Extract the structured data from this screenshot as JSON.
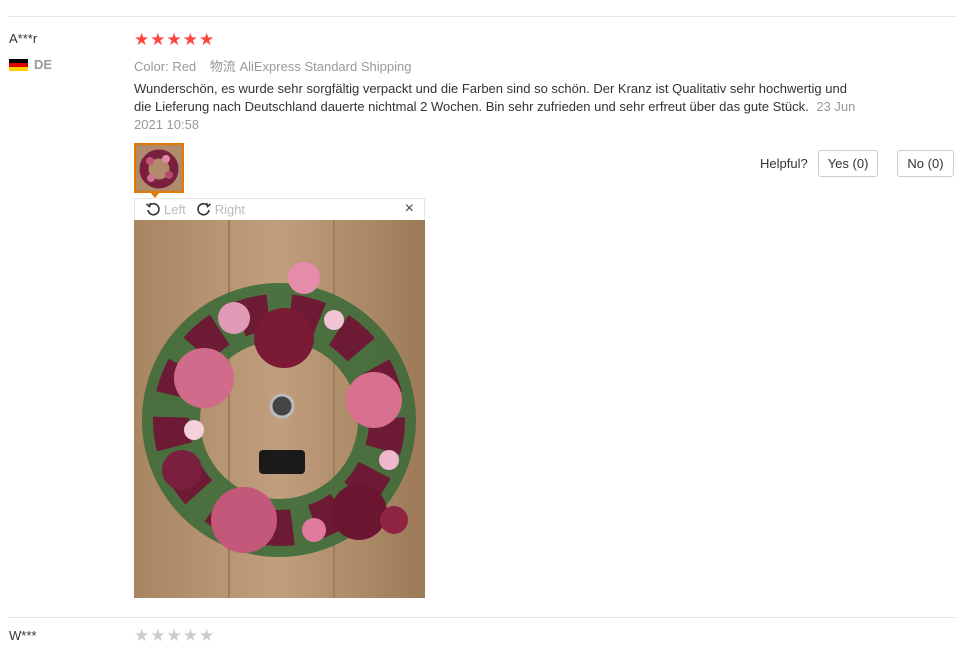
{
  "review": {
    "user": "A***r",
    "country": "DE",
    "rating": 5,
    "stars": [
      "★",
      "★",
      "★",
      "★",
      "★"
    ],
    "color_label": "Color:",
    "color_value": "Red",
    "shipping_label": "物流",
    "shipping_value": "AliExpress Standard Shipping",
    "text": "Wunderschön, es wurde sehr sorgfältig verpackt und die Farben sind so schön. Der Kranz ist Qualitativ sehr hochwertig und die Lieferung nach Deutschland dauerte nichtmal 2 Wochen. Bin sehr zufrieden und sehr erfreut über das gute Stück.",
    "date": "23 Jun 2021 10:58"
  },
  "helpful": {
    "label": "Helpful?",
    "yes": "Yes (0)",
    "no": "No (0)"
  },
  "viewer": {
    "rotate_left": "Left",
    "rotate_right": "Right",
    "close": "×"
  },
  "next_review": {
    "user": "W***",
    "stars": [
      "★",
      "★",
      "★",
      "★",
      "★"
    ]
  },
  "colors": {
    "star": "#ff4444",
    "thumb_border": "#e07b00",
    "muted": "#999999"
  },
  "icons": {
    "rotate_left": "rotate-left-icon",
    "rotate_right": "rotate-right-icon",
    "close": "close-icon",
    "flag": "germany-flag-icon"
  }
}
